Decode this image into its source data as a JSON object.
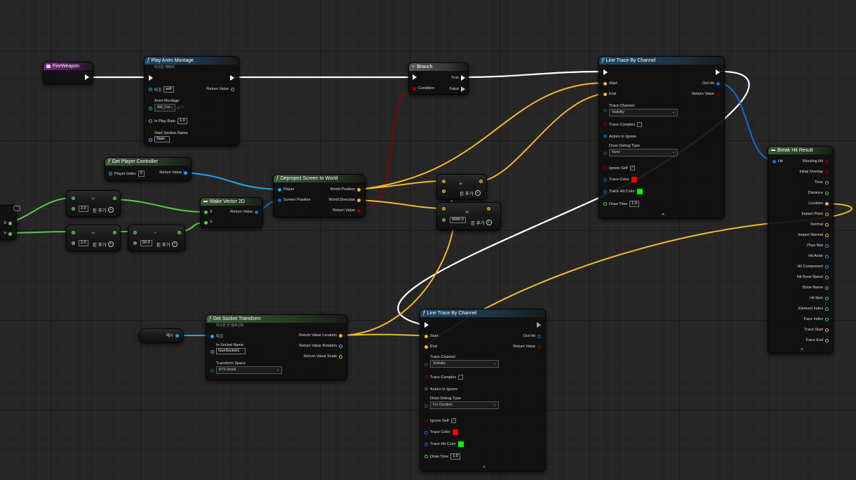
{
  "colors": {
    "exec": "#ffffff",
    "float": "#5cc84a",
    "vector": "#f0b92c",
    "object": "#1ea4f0",
    "bool": "#8c0000",
    "struct": "#1a68d8",
    "name": "#b48ce0",
    "trace_red": "#ff0000",
    "trace_green": "#00ff00"
  },
  "fire_weapon": {
    "title": "FireWeapon",
    "icon": "event-icon"
  },
  "play_anim": {
    "title": "Play Anim Montage",
    "subtitle": "타깃은 캐릭터",
    "target_label": "타깃",
    "target_value": "self",
    "return_label": "Return Value",
    "montage_label": "Anim Montage",
    "montage_value": "AM_Fire",
    "rate_label": "In Play Rate",
    "rate_value": "1.0",
    "section_label": "Start Section Name",
    "section_value": "Start"
  },
  "branch": {
    "title": "Branch",
    "true_label": "True",
    "condition_label": "Condition",
    "false_label": "False"
  },
  "get_pc": {
    "title": "Get Player Controller",
    "index_label": "Player Index",
    "index_value": "0",
    "return_label": "Return Value"
  },
  "deproject": {
    "title": "Deproject Screen to World",
    "player_label": "Player",
    "screen_label": "Screen Position",
    "world_pos_label": "World Position",
    "world_dir_label": "World Direction",
    "return_label": "Return Value"
  },
  "make_vec": {
    "title": "Make Vector 2D",
    "x_label": "X",
    "y_label": "Y",
    "return_label": "Return Value"
  },
  "viewport": {
    "x_label": "X",
    "y_label": "Y"
  },
  "div1": {
    "op": "÷",
    "value": "2.0",
    "add_pin": "핀 추가"
  },
  "div2": {
    "op": "÷",
    "value": "2.0",
    "add_pin": "핀 추가"
  },
  "sub1": {
    "op": "-",
    "value": "60.0",
    "add_pin": "핀 추가"
  },
  "add_node": {
    "op": "+",
    "add_pin": "핀 추가"
  },
  "mul_node": {
    "op": "×",
    "value": "5000.0",
    "add_pin": "핀 추가"
  },
  "trace1": {
    "title": "Line Trace By Channel",
    "start_label": "Start",
    "end_label": "End",
    "outhit_label": "Out Hit",
    "return_label": "Return Value",
    "channel_label": "Trace Channel",
    "channel_value": "Visibility",
    "complex_label": "Trace Complex",
    "ignore_actors_label": "Actors to Ignore",
    "debug_label": "Draw Debug Type",
    "debug_value": "None",
    "ignore_self_label": "Ignore Self",
    "color_label": "Trace Color",
    "hit_color_label": "Trace Hit Color",
    "time_label": "Draw Time",
    "time_value": "1.0"
  },
  "trace2": {
    "title": "Line Trace By Channel",
    "start_label": "Start",
    "end_label": "End",
    "outhit_label": "Out Hit",
    "return_label": "Return Value",
    "channel_label": "Trace Channel",
    "channel_value": "Visibility",
    "complex_label": "Trace Complex",
    "ignore_actors_label": "Actors to Ignore",
    "debug_label": "Draw Debug Type",
    "debug_value": "For Duration",
    "ignore_self_label": "Ignore Self",
    "color_label": "Trace Color",
    "hit_color_label": "Trace Hit Color",
    "time_label": "Draw Time",
    "time_value": "1.0"
  },
  "mesh_var": {
    "label": "메시"
  },
  "socket": {
    "title": "Get Socket Transform",
    "subtitle": "타깃은 씬 컴포넌트",
    "target_label": "타깃",
    "socket_label": "In Socket Name",
    "socket_value": "GunSocket1",
    "space_label": "Transform Space",
    "space_value": "RTS World",
    "loc_label": "Return Value Location",
    "rot_label": "Return Value Rotation",
    "scale_label": "Return Value Scale"
  },
  "break_hit": {
    "title": "Break Hit Result",
    "hit_label": "Hit",
    "pins": [
      "Blocking Hit",
      "Initial Overlap",
      "Time",
      "Distance",
      "Location",
      "Impact Point",
      "Normal",
      "Impact Normal",
      "Phys Mat",
      "Hit Actor",
      "Hit Component",
      "Hit Bone Name",
      "Bone Name",
      "Hit Item",
      "Element Index",
      "Face Index",
      "Trace Start",
      "Trace End"
    ]
  }
}
